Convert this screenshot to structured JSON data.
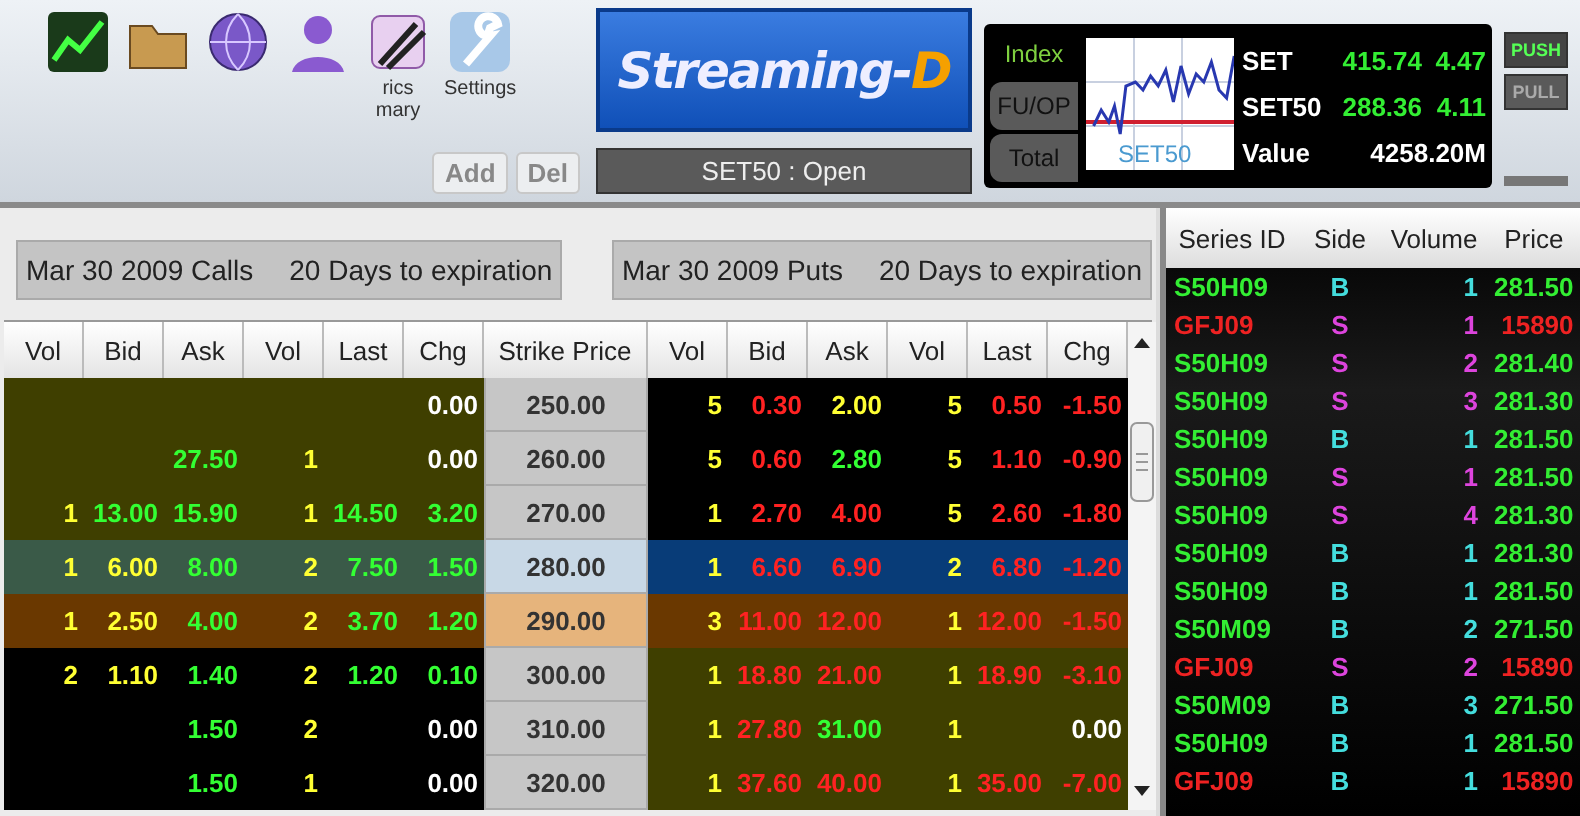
{
  "toolbar": {
    "tools": [
      {
        "kind": "chart"
      },
      {
        "kind": "folder"
      },
      {
        "kind": "globe"
      },
      {
        "kind": "person"
      },
      {
        "kind": "pen",
        "label_lines": [
          "rics",
          "mary"
        ]
      },
      {
        "kind": "wrench",
        "label_lines": [
          "Settings"
        ]
      }
    ],
    "logo": {
      "text": "Streaming-",
      "accent": "D"
    },
    "buttons": [
      "Add",
      "Del"
    ],
    "market_status": "SET50 : Open"
  },
  "index_panel": {
    "tabs": [
      {
        "label": "Index",
        "selected": true
      },
      {
        "label": "FU/OP",
        "selected": false
      },
      {
        "label": "Total",
        "selected": false
      }
    ],
    "chart_label": "SET50",
    "quotes": [
      {
        "name": "SET",
        "last": "415.74",
        "change": "4.47"
      },
      {
        "name": "SET50",
        "last": "288.36",
        "change": "4.11"
      }
    ],
    "value": {
      "label": "Value",
      "amount": "4258.20M"
    },
    "feed_buttons": [
      {
        "label": "PUSH",
        "on": true
      },
      {
        "label": "PULL",
        "on": false
      }
    ]
  },
  "options": {
    "calls_title": "Mar 30 2009 Calls",
    "calls_expiry": "20 Days to expiration",
    "puts_title": "Mar 30 2009 Puts",
    "puts_expiry": "20 Days to expiration",
    "columns": [
      "Vol",
      "Bid",
      "Ask",
      "Vol",
      "Last",
      "Chg",
      "Strike Price",
      "Vol",
      "Bid",
      "Ask",
      "Vol",
      "Last",
      "Chg"
    ],
    "rows": [
      {
        "strike": {
          "text": "250.00",
          "color": "#c6c6c6"
        },
        "calls": {
          "color": "#3f3f00",
          "chg": {
            "text": "0.00",
            "color": "#ffffff"
          }
        },
        "puts": {
          "color": "#000000",
          "bid_vol": {
            "text": "5",
            "color": "#ffff33"
          },
          "bid": {
            "text": "0.30",
            "color": "#ff2222"
          },
          "ask": {
            "text": "2.00",
            "color": "#ffff33"
          },
          "ask_vol": {
            "text": "5",
            "color": "#ffff33"
          },
          "last": {
            "text": "0.50",
            "color": "#ff2222"
          },
          "chg": {
            "text": "-1.50",
            "color": "#ff2222"
          }
        }
      },
      {
        "strike": {
          "text": "260.00",
          "color": "#c6c6c6"
        },
        "calls": {
          "color": "#3f3f00",
          "ask": {
            "text": "27.50",
            "color": "#33ff33"
          },
          "ask_vol": {
            "text": "1",
            "color": "#ffff33"
          },
          "chg": {
            "text": "0.00",
            "color": "#ffffff"
          }
        },
        "puts": {
          "color": "#000000",
          "bid_vol": {
            "text": "5",
            "color": "#ffff33"
          },
          "bid": {
            "text": "0.60",
            "color": "#ff2222"
          },
          "ask": {
            "text": "2.80",
            "color": "#33ff33"
          },
          "ask_vol": {
            "text": "5",
            "color": "#ffff33"
          },
          "last": {
            "text": "1.10",
            "color": "#ff2222"
          },
          "chg": {
            "text": "-0.90",
            "color": "#ff2222"
          }
        }
      },
      {
        "strike": {
          "text": "270.00",
          "color": "#c6c6c6"
        },
        "calls": {
          "color": "#3f3f00",
          "bid_vol": {
            "text": "1",
            "color": "#ffff33"
          },
          "bid": {
            "text": "13.00",
            "color": "#33ff33"
          },
          "ask": {
            "text": "15.90",
            "color": "#33ff33"
          },
          "ask_vol": {
            "text": "1",
            "color": "#ffff33"
          },
          "last": {
            "text": "14.50",
            "color": "#33ff33"
          },
          "chg": {
            "text": "3.20",
            "color": "#33ff33"
          }
        },
        "puts": {
          "color": "#000000",
          "bid_vol": {
            "text": "1",
            "color": "#ffff33"
          },
          "bid": {
            "text": "2.70",
            "color": "#ff2222"
          },
          "ask": {
            "text": "4.00",
            "color": "#ff2222"
          },
          "ask_vol": {
            "text": "5",
            "color": "#ffff33"
          },
          "last": {
            "text": "2.60",
            "color": "#ff2222"
          },
          "chg": {
            "text": "-1.80",
            "color": "#ff2222"
          }
        }
      },
      {
        "strike": {
          "text": "280.00",
          "color": "#c8d8e6"
        },
        "calls": {
          "color": "#3a5a48",
          "bid_vol": {
            "text": "1",
            "color": "#ffff33"
          },
          "bid": {
            "text": "6.00",
            "color": "#ffff33"
          },
          "ask": {
            "text": "8.00",
            "color": "#33ff33"
          },
          "ask_vol": {
            "text": "2",
            "color": "#ffff33"
          },
          "last": {
            "text": "7.50",
            "color": "#33ff33"
          },
          "chg": {
            "text": "1.50",
            "color": "#33ff33"
          }
        },
        "puts": {
          "color": "#083c78",
          "bid_vol": {
            "text": "1",
            "color": "#ffff33"
          },
          "bid": {
            "text": "6.60",
            "color": "#ff2222"
          },
          "ask": {
            "text": "6.90",
            "color": "#ff2222"
          },
          "ask_vol": {
            "text": "2",
            "color": "#ffff33"
          },
          "last": {
            "text": "6.80",
            "color": "#ff2222"
          },
          "chg": {
            "text": "-1.20",
            "color": "#ff2222"
          }
        }
      },
      {
        "strike": {
          "text": "290.00",
          "color": "#e6b47c"
        },
        "calls": {
          "color": "#6a3800",
          "bid_vol": {
            "text": "1",
            "color": "#ffff33"
          },
          "bid": {
            "text": "2.50",
            "color": "#ffff33"
          },
          "ask": {
            "text": "4.00",
            "color": "#33ff33"
          },
          "ask_vol": {
            "text": "2",
            "color": "#ffff33"
          },
          "last": {
            "text": "3.70",
            "color": "#33ff33"
          },
          "chg": {
            "text": "1.20",
            "color": "#33ff33"
          }
        },
        "puts": {
          "color": "#6a3800",
          "bid_vol": {
            "text": "3",
            "color": "#ffff33"
          },
          "bid": {
            "text": "11.00",
            "color": "#ff2222"
          },
          "ask": {
            "text": "12.00",
            "color": "#ff2222"
          },
          "ask_vol": {
            "text": "1",
            "color": "#ffff33"
          },
          "last": {
            "text": "12.00",
            "color": "#ff2222"
          },
          "chg": {
            "text": "-1.50",
            "color": "#ff2222"
          }
        }
      },
      {
        "strike": {
          "text": "300.00",
          "color": "#c6c6c6"
        },
        "calls": {
          "color": "#000000",
          "bid_vol": {
            "text": "2",
            "color": "#ffff33"
          },
          "bid": {
            "text": "1.10",
            "color": "#ffff33"
          },
          "ask": {
            "text": "1.40",
            "color": "#33ff33"
          },
          "ask_vol": {
            "text": "2",
            "color": "#ffff33"
          },
          "last": {
            "text": "1.20",
            "color": "#33ff33"
          },
          "chg": {
            "text": "0.10",
            "color": "#33ff33"
          }
        },
        "puts": {
          "color": "#3f3f00",
          "bid_vol": {
            "text": "1",
            "color": "#ffff33"
          },
          "bid": {
            "text": "18.80",
            "color": "#ff2222"
          },
          "ask": {
            "text": "21.00",
            "color": "#ff2222"
          },
          "ask_vol": {
            "text": "1",
            "color": "#ffff33"
          },
          "last": {
            "text": "18.90",
            "color": "#ff2222"
          },
          "chg": {
            "text": "-3.10",
            "color": "#ff2222"
          }
        }
      },
      {
        "strike": {
          "text": "310.00",
          "color": "#c6c6c6"
        },
        "calls": {
          "color": "#000000",
          "ask": {
            "text": "1.50",
            "color": "#33ff33"
          },
          "ask_vol": {
            "text": "2",
            "color": "#ffff33"
          },
          "chg": {
            "text": "0.00",
            "color": "#ffffff"
          }
        },
        "puts": {
          "color": "#3f3f00",
          "bid_vol": {
            "text": "1",
            "color": "#ffff33"
          },
          "bid": {
            "text": "27.80",
            "color": "#ff2222"
          },
          "ask": {
            "text": "31.00",
            "color": "#33ff33"
          },
          "ask_vol": {
            "text": "1",
            "color": "#ffff33"
          },
          "chg": {
            "text": "0.00",
            "color": "#ffffff"
          }
        }
      },
      {
        "strike": {
          "text": "320.00",
          "color": "#c6c6c6"
        },
        "calls": {
          "color": "#000000",
          "ask": {
            "text": "1.50",
            "color": "#33ff33"
          },
          "ask_vol": {
            "text": "1",
            "color": "#ffff33"
          },
          "chg": {
            "text": "0.00",
            "color": "#ffffff"
          }
        },
        "puts": {
          "color": "#3f3f00",
          "bid_vol": {
            "text": "1",
            "color": "#ffff33"
          },
          "bid": {
            "text": "37.60",
            "color": "#ff2222"
          },
          "ask": {
            "text": "40.00",
            "color": "#ff2222"
          },
          "ask_vol": {
            "text": "1",
            "color": "#ffff33"
          },
          "last": {
            "text": "35.00",
            "color": "#ff2222"
          },
          "chg": {
            "text": "-7.00",
            "color": "#ff2222"
          }
        }
      }
    ]
  },
  "trades": {
    "columns": [
      "Series ID",
      "Side",
      "Volume",
      "Price"
    ],
    "rows": [
      {
        "series": "S50H09",
        "color": "#33ee33",
        "side": {
          "text": "B",
          "color": "#44dddd"
        },
        "volume": "1",
        "price": "281.50"
      },
      {
        "series": "GFJ09",
        "color": "#ee2222",
        "side": {
          "text": "S",
          "color": "#dd44dd"
        },
        "volume": "1",
        "price": "15890"
      },
      {
        "series": "S50H09",
        "color": "#33ee33",
        "side": {
          "text": "S",
          "color": "#dd44dd"
        },
        "volume": "2",
        "price": "281.40"
      },
      {
        "series": "S50H09",
        "color": "#33ee33",
        "side": {
          "text": "S",
          "color": "#dd44dd"
        },
        "volume": "3",
        "price": "281.30"
      },
      {
        "series": "S50H09",
        "color": "#33ee33",
        "side": {
          "text": "B",
          "color": "#44dddd"
        },
        "volume": "1",
        "price": "281.50"
      },
      {
        "series": "S50H09",
        "color": "#33ee33",
        "side": {
          "text": "S",
          "color": "#dd44dd"
        },
        "volume": "1",
        "price": "281.50"
      },
      {
        "series": "S50H09",
        "color": "#33ee33",
        "side": {
          "text": "S",
          "color": "#dd44dd"
        },
        "volume": "4",
        "price": "281.30"
      },
      {
        "series": "S50H09",
        "color": "#33ee33",
        "side": {
          "text": "B",
          "color": "#44dddd"
        },
        "volume": "1",
        "price": "281.30"
      },
      {
        "series": "S50H09",
        "color": "#33ee33",
        "side": {
          "text": "B",
          "color": "#44dddd"
        },
        "volume": "1",
        "price": "281.50"
      },
      {
        "series": "S50M09",
        "color": "#33ee33",
        "side": {
          "text": "B",
          "color": "#44dddd"
        },
        "volume": "2",
        "price": "271.50"
      },
      {
        "series": "GFJ09",
        "color": "#ee2222",
        "side": {
          "text": "S",
          "color": "#dd44dd"
        },
        "volume": "2",
        "price": "15890"
      },
      {
        "series": "S50M09",
        "color": "#33ee33",
        "side": {
          "text": "B",
          "color": "#44dddd"
        },
        "volume": "3",
        "price": "271.50"
      },
      {
        "series": "S50H09",
        "color": "#33ee33",
        "side": {
          "text": "B",
          "color": "#44dddd"
        },
        "volume": "1",
        "price": "281.50"
      },
      {
        "series": "GFJ09",
        "color": "#ee2222",
        "side": {
          "text": "B",
          "color": "#44dddd"
        },
        "volume": "1",
        "price": "15890"
      }
    ]
  }
}
